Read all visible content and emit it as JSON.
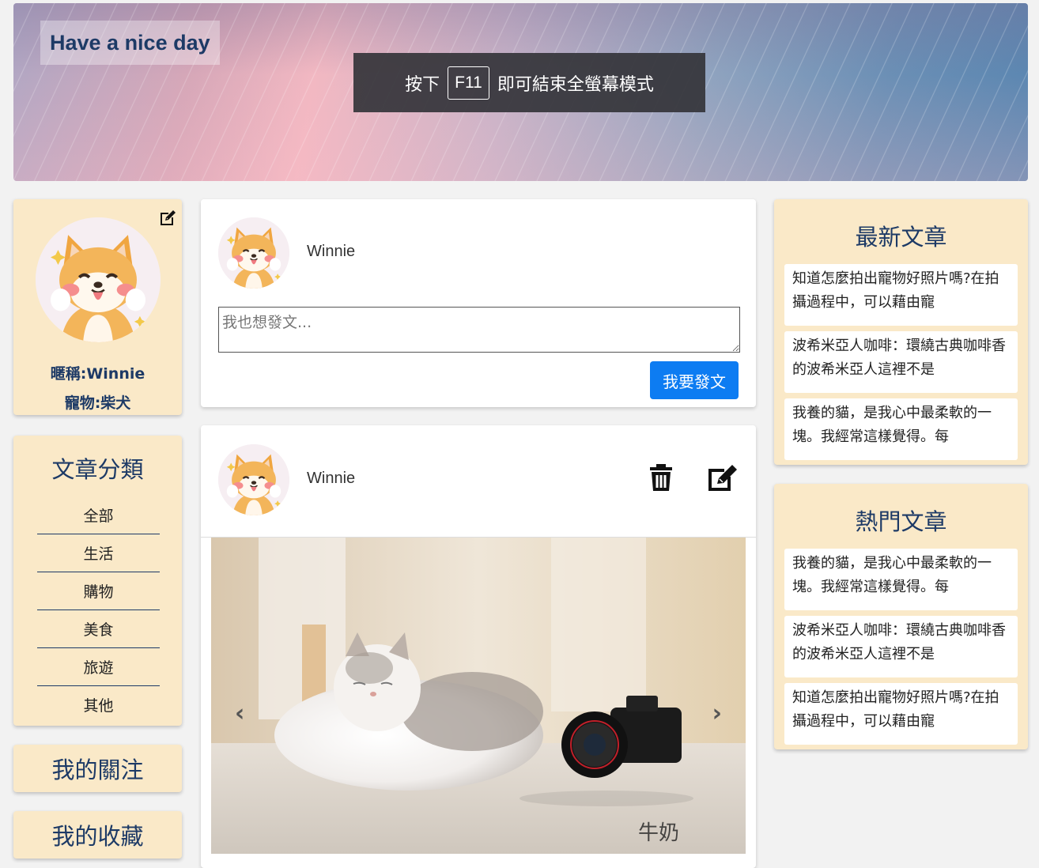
{
  "banner": {
    "greeting": "Have a nice day",
    "fullscreen_prefix": "按下",
    "fullscreen_key": "F11",
    "fullscreen_suffix": "即可結束全螢幕模式"
  },
  "profile": {
    "nickname": "暱稱:Winnie",
    "pet": "寵物:柴犬"
  },
  "categories": {
    "title": "文章分類",
    "items": [
      "全部",
      "生活",
      "購物",
      "美食",
      "旅遊",
      "其他"
    ]
  },
  "side_links": {
    "follow": "我的關注",
    "favorites": "我的收藏"
  },
  "composer": {
    "username": "Winnie",
    "placeholder": "我也想發文...",
    "post_label": "我要發文"
  },
  "post": {
    "username": "Winnie"
  },
  "latest": {
    "title": "最新文章",
    "items": [
      "知道怎麼拍出寵物好照片嗎?在拍攝過程中，可以藉由寵",
      "波希米亞人咖啡：環繞古典咖啡香的波希米亞人這裡不是",
      "我養的貓，是我心中最柔軟的一塊。我經常這樣覺得。每"
    ]
  },
  "popular": {
    "title": "熱門文章",
    "items": [
      "我養的貓，是我心中最柔軟的一塊。我經常這樣覺得。每",
      "波希米亞人咖啡：環繞古典咖啡香的波希米亞人這裡不是",
      "知道怎麼拍出寵物好照片嗎?在拍攝過程中，可以藉由寵"
    ]
  },
  "colors": {
    "accent": "#0d7cf2",
    "card_beige": "#fae9c8",
    "heading_navy": "#1d3a66"
  }
}
